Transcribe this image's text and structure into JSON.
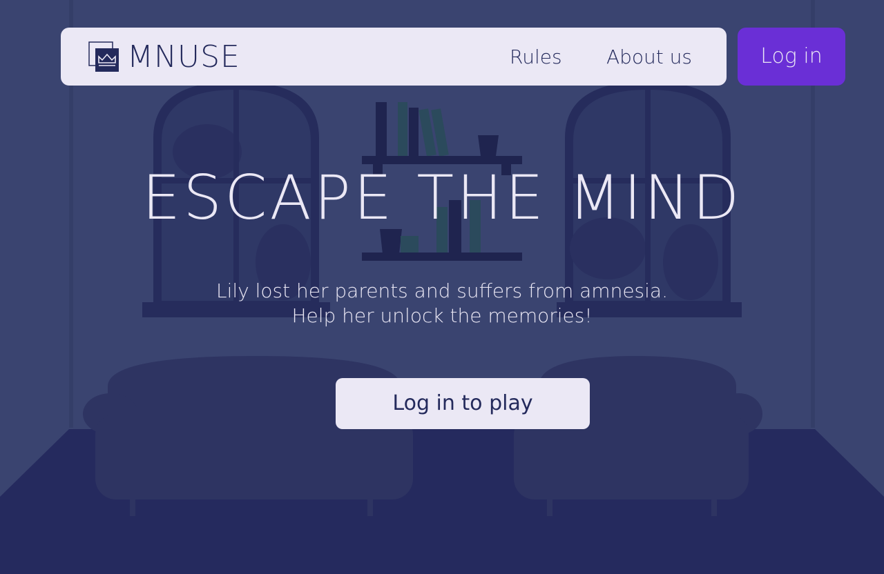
{
  "brand": {
    "name": "MNUSE"
  },
  "nav": {
    "rules": "Rules",
    "about": "About us"
  },
  "header_login": "Log in",
  "hero": {
    "title": "ESCAPE THE MIND",
    "line1": "Lily lost her parents and suffers from amnesia.",
    "line2": "Help her unlock the memories!",
    "cta": "Log in to play"
  },
  "colors": {
    "background": "#3a4470",
    "nav_bg": "#ebe8f5",
    "accent": "#6a2fd6",
    "text_dark": "#242a5c",
    "text_light": "#ebe8f5"
  },
  "icons": {
    "logo": "crown-logo-icon"
  }
}
